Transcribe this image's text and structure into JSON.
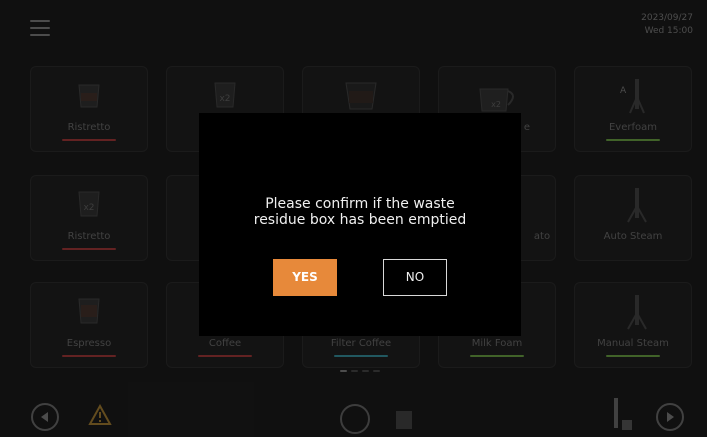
{
  "header": {
    "date": "2023/09/27",
    "time": "Wed  15:00"
  },
  "tiles": [
    {
      "label": "Ristretto",
      "icon": "espresso-cup-icon",
      "accent": "#8a3030"
    },
    {
      "label": "",
      "icon": "double-shot-cup-icon",
      "accent": "#8a3030"
    },
    {
      "label": "",
      "icon": "glass-cup-icon",
      "accent": "#2f7a86"
    },
    {
      "label": "e",
      "icon": "milk-jug-icon",
      "badge": "x2",
      "accent": "#5a8a3a"
    },
    {
      "label": "Everfoam",
      "icon": "steam-wand-icon",
      "accent": "#5a8a3a"
    },
    {
      "label": "Ristretto",
      "icon": "double-shot-cup-icon",
      "accent": "#8a3030"
    },
    {
      "label": "",
      "icon": "",
      "accent": ""
    },
    {
      "label": "",
      "icon": "",
      "accent": ""
    },
    {
      "label": "ato",
      "icon": "",
      "accent": "#5a8a3a"
    },
    {
      "label": "Auto Steam",
      "icon": "steam-wand-icon",
      "accent": "#5a8a3a"
    },
    {
      "label": "Espresso",
      "icon": "espresso-cup-icon",
      "accent": "#8a3030"
    },
    {
      "label": "Coffee",
      "icon": "",
      "accent": "#8a3030"
    },
    {
      "label": "Filter Coffee",
      "icon": "",
      "accent": "#2f7a86"
    },
    {
      "label": "Milk Foam",
      "icon": "",
      "accent": "#5a8a3a"
    },
    {
      "label": "Manual Steam",
      "icon": "steam-wand-icon",
      "accent": "#5a8a3a"
    }
  ],
  "dialog": {
    "message_line1": "Please confirm if the waste",
    "message_line2": "residue box has been emptied",
    "yes_label": "YES",
    "no_label": "NO"
  },
  "bottom_bar": {
    "left_nav": "chevron-left-icon",
    "warning": "warning-icon",
    "clean": "clean-cycle-icon",
    "right_nav": "chevron-right-icon"
  },
  "colors": {
    "accent": "#e7893a",
    "background": "#171717"
  }
}
